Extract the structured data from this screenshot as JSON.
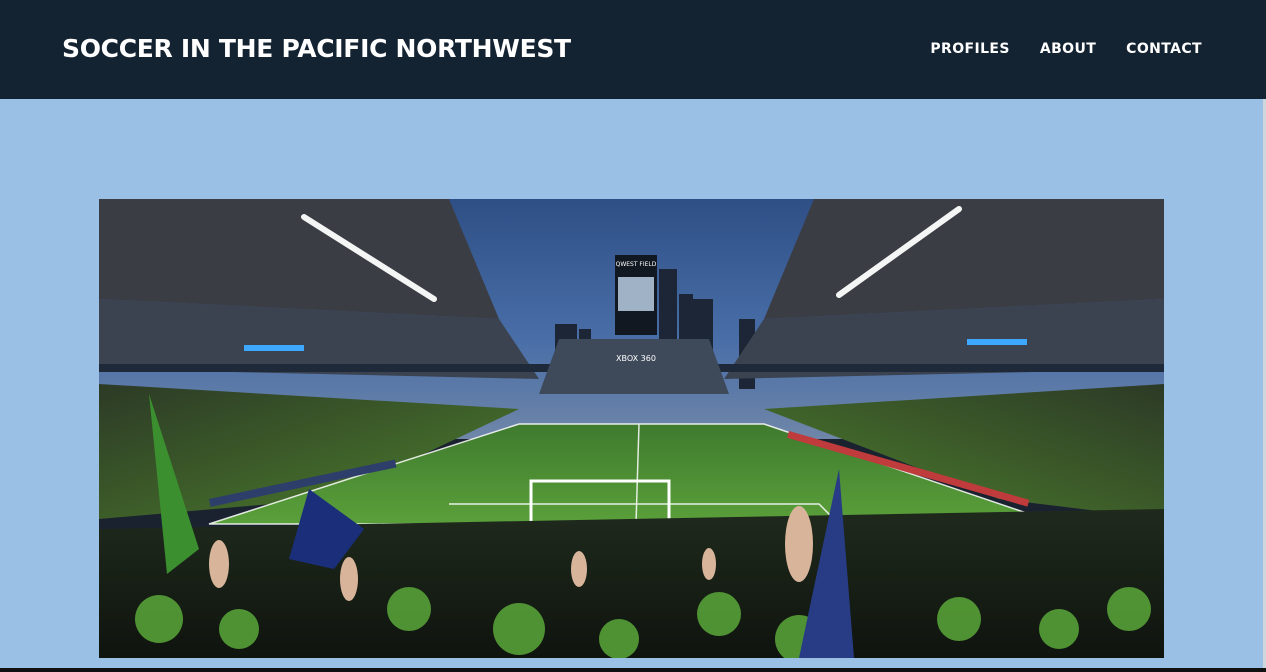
{
  "header": {
    "site_title": "SOCCER IN THE PACIFIC NORTHWEST",
    "background": "#142332",
    "nav": [
      {
        "label": "PROFILES"
      },
      {
        "label": "ABOUT"
      },
      {
        "label": "CONTACT"
      }
    ]
  },
  "page": {
    "background": "#9ac0e6"
  },
  "hero": {
    "description_kind": "photo",
    "stadium_signage": {
      "scoreboard_top": "QWEST FIELD",
      "pitch_sign": "XBOX 360"
    }
  }
}
